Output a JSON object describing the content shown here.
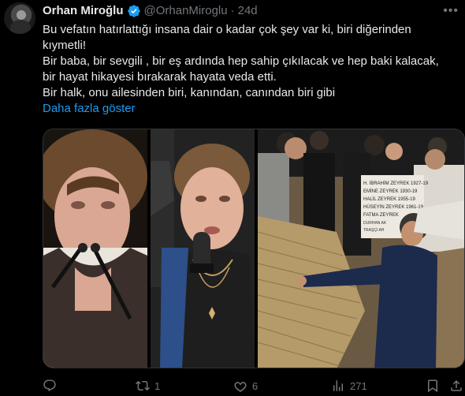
{
  "author": {
    "name": "Orhan Miroğlu",
    "handle": "@OrhanMiroglu",
    "separator": "·",
    "time": "24d"
  },
  "tweet": {
    "lines": [
      "Bu vefatın hatırlattığı insana dair o kadar çok şey var ki, biri diğerinden",
      "kıymetli!",
      "Bir baba, bir sevgili , bir eş ardında hep sahip çıkılacak ve hep baki kalacak,",
      "bir hayat hikayesi bırakarak hayata veda etti.",
      "Bir halk, onu ailesinden biri, kanından, canından biri gibi"
    ],
    "show_more": "Daha fazla göster"
  },
  "media": {
    "gravestone_lines": [
      "H. İBRAHİM ZEYREK 1927-19",
      "EMİNE ZEYREK 1930-19",
      "HALİL ZEYREK 1955-19",
      "HÜSEYİN ZEYREK 1961-19",
      "FATMA ZEYREK",
      "DURHAN AK",
      "TRAŞÇI AH"
    ]
  },
  "actions": {
    "replies": "",
    "retweets": "1",
    "likes": "6",
    "views": "271"
  },
  "colors": {
    "background": "#000000",
    "text": "#e7e9ea",
    "muted": "#71767b",
    "accent": "#1d9bf0"
  }
}
